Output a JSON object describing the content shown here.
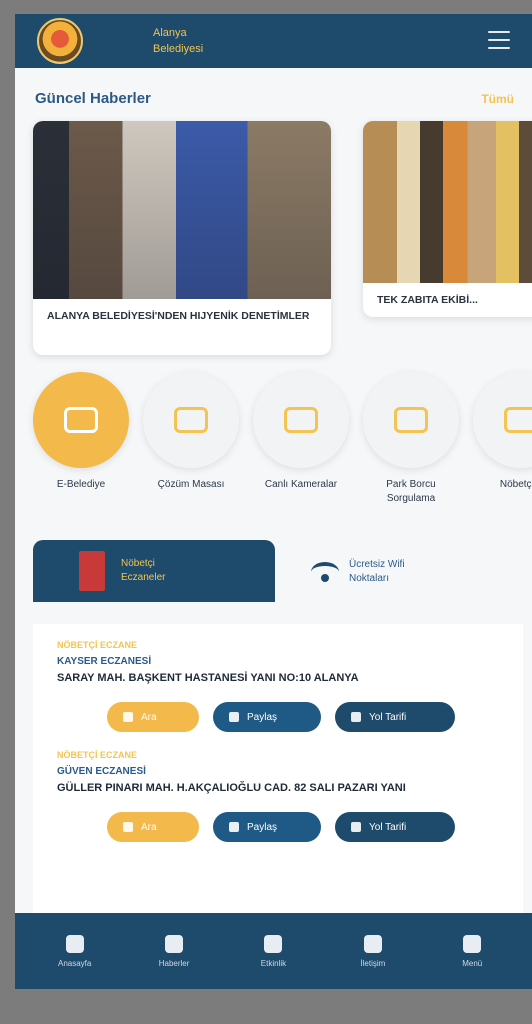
{
  "header": {
    "brand_line1": "Alanya",
    "brand_line2": "Belediyesi"
  },
  "news": {
    "title": "Güncel Haberler",
    "see_all": "Tümü",
    "cards": [
      {
        "text": "ALANYA BELEDİYESİ'NDEN HIJYENİK DENETİMLER"
      },
      {
        "text": "TEK ZABITA EKİBİ..."
      }
    ]
  },
  "services": [
    {
      "label": "E-Belediye"
    },
    {
      "label": "Çözüm Masası"
    },
    {
      "label": "Canlı Kameralar"
    },
    {
      "label": "Park Borcu Sorgulama"
    },
    {
      "label": "Nöbetçi..."
    }
  ],
  "tabs": {
    "active": {
      "label_line1": "Nöbetçi",
      "label_line2": "Eczaneler"
    },
    "inactive": {
      "label_line1": "Ücretsiz Wifi",
      "label_line2": "Noktaları"
    }
  },
  "pharmacies": [
    {
      "tag": "NÖBETÇİ ECZANE",
      "name": "KAYSER ECZANESİ",
      "address": "SARAY MAH. BAŞKENT HASTANESİ YANI NO:10 ALANYA",
      "btn_call": "Ara",
      "btn_share": "Paylaş",
      "btn_route": "Yol Tarifi"
    },
    {
      "tag": "NÖBETÇİ ECZANE",
      "name": "GÜVEN ECZANESİ",
      "address": "GÜLLER PINARI MAH. H.AKÇALIOĞLU CAD. 82 SALI PAZARI YANI",
      "btn_call": "Ara",
      "btn_share": "Paylaş",
      "btn_route": "Yol Tarifi"
    }
  ],
  "bottom_nav": [
    {
      "label": "Anasayfa"
    },
    {
      "label": "Haberler"
    },
    {
      "label": "Etkinlik"
    },
    {
      "label": "İletişim"
    },
    {
      "label": "Menü"
    }
  ],
  "colors": {
    "primary": "#1e4a6b",
    "accent": "#f3b94a",
    "title": "#2d5a84",
    "background": "#f6f7f9"
  }
}
